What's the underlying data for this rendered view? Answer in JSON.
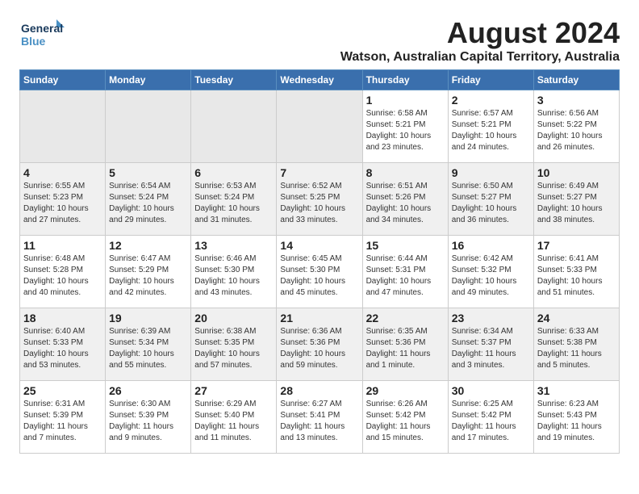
{
  "logo": {
    "line1": "General",
    "line2": "Blue",
    "icon_color": "#4a90c4"
  },
  "title": "August 2024",
  "subtitle": "Watson, Australian Capital Territory, Australia",
  "days_of_week": [
    "Sunday",
    "Monday",
    "Tuesday",
    "Wednesday",
    "Thursday",
    "Friday",
    "Saturday"
  ],
  "weeks": [
    [
      {
        "day": "",
        "info": ""
      },
      {
        "day": "",
        "info": ""
      },
      {
        "day": "",
        "info": ""
      },
      {
        "day": "",
        "info": ""
      },
      {
        "day": "1",
        "info": "Sunrise: 6:58 AM\nSunset: 5:21 PM\nDaylight: 10 hours\nand 23 minutes."
      },
      {
        "day": "2",
        "info": "Sunrise: 6:57 AM\nSunset: 5:21 PM\nDaylight: 10 hours\nand 24 minutes."
      },
      {
        "day": "3",
        "info": "Sunrise: 6:56 AM\nSunset: 5:22 PM\nDaylight: 10 hours\nand 26 minutes."
      }
    ],
    [
      {
        "day": "4",
        "info": "Sunrise: 6:55 AM\nSunset: 5:23 PM\nDaylight: 10 hours\nand 27 minutes."
      },
      {
        "day": "5",
        "info": "Sunrise: 6:54 AM\nSunset: 5:24 PM\nDaylight: 10 hours\nand 29 minutes."
      },
      {
        "day": "6",
        "info": "Sunrise: 6:53 AM\nSunset: 5:24 PM\nDaylight: 10 hours\nand 31 minutes."
      },
      {
        "day": "7",
        "info": "Sunrise: 6:52 AM\nSunset: 5:25 PM\nDaylight: 10 hours\nand 33 minutes."
      },
      {
        "day": "8",
        "info": "Sunrise: 6:51 AM\nSunset: 5:26 PM\nDaylight: 10 hours\nand 34 minutes."
      },
      {
        "day": "9",
        "info": "Sunrise: 6:50 AM\nSunset: 5:27 PM\nDaylight: 10 hours\nand 36 minutes."
      },
      {
        "day": "10",
        "info": "Sunrise: 6:49 AM\nSunset: 5:27 PM\nDaylight: 10 hours\nand 38 minutes."
      }
    ],
    [
      {
        "day": "11",
        "info": "Sunrise: 6:48 AM\nSunset: 5:28 PM\nDaylight: 10 hours\nand 40 minutes."
      },
      {
        "day": "12",
        "info": "Sunrise: 6:47 AM\nSunset: 5:29 PM\nDaylight: 10 hours\nand 42 minutes."
      },
      {
        "day": "13",
        "info": "Sunrise: 6:46 AM\nSunset: 5:30 PM\nDaylight: 10 hours\nand 43 minutes."
      },
      {
        "day": "14",
        "info": "Sunrise: 6:45 AM\nSunset: 5:30 PM\nDaylight: 10 hours\nand 45 minutes."
      },
      {
        "day": "15",
        "info": "Sunrise: 6:44 AM\nSunset: 5:31 PM\nDaylight: 10 hours\nand 47 minutes."
      },
      {
        "day": "16",
        "info": "Sunrise: 6:42 AM\nSunset: 5:32 PM\nDaylight: 10 hours\nand 49 minutes."
      },
      {
        "day": "17",
        "info": "Sunrise: 6:41 AM\nSunset: 5:33 PM\nDaylight: 10 hours\nand 51 minutes."
      }
    ],
    [
      {
        "day": "18",
        "info": "Sunrise: 6:40 AM\nSunset: 5:33 PM\nDaylight: 10 hours\nand 53 minutes."
      },
      {
        "day": "19",
        "info": "Sunrise: 6:39 AM\nSunset: 5:34 PM\nDaylight: 10 hours\nand 55 minutes."
      },
      {
        "day": "20",
        "info": "Sunrise: 6:38 AM\nSunset: 5:35 PM\nDaylight: 10 hours\nand 57 minutes."
      },
      {
        "day": "21",
        "info": "Sunrise: 6:36 AM\nSunset: 5:36 PM\nDaylight: 10 hours\nand 59 minutes."
      },
      {
        "day": "22",
        "info": "Sunrise: 6:35 AM\nSunset: 5:36 PM\nDaylight: 11 hours\nand 1 minute."
      },
      {
        "day": "23",
        "info": "Sunrise: 6:34 AM\nSunset: 5:37 PM\nDaylight: 11 hours\nand 3 minutes."
      },
      {
        "day": "24",
        "info": "Sunrise: 6:33 AM\nSunset: 5:38 PM\nDaylight: 11 hours\nand 5 minutes."
      }
    ],
    [
      {
        "day": "25",
        "info": "Sunrise: 6:31 AM\nSunset: 5:39 PM\nDaylight: 11 hours\nand 7 minutes."
      },
      {
        "day": "26",
        "info": "Sunrise: 6:30 AM\nSunset: 5:39 PM\nDaylight: 11 hours\nand 9 minutes."
      },
      {
        "day": "27",
        "info": "Sunrise: 6:29 AM\nSunset: 5:40 PM\nDaylight: 11 hours\nand 11 minutes."
      },
      {
        "day": "28",
        "info": "Sunrise: 6:27 AM\nSunset: 5:41 PM\nDaylight: 11 hours\nand 13 minutes."
      },
      {
        "day": "29",
        "info": "Sunrise: 6:26 AM\nSunset: 5:42 PM\nDaylight: 11 hours\nand 15 minutes."
      },
      {
        "day": "30",
        "info": "Sunrise: 6:25 AM\nSunset: 5:42 PM\nDaylight: 11 hours\nand 17 minutes."
      },
      {
        "day": "31",
        "info": "Sunrise: 6:23 AM\nSunset: 5:43 PM\nDaylight: 11 hours\nand 19 minutes."
      }
    ]
  ]
}
